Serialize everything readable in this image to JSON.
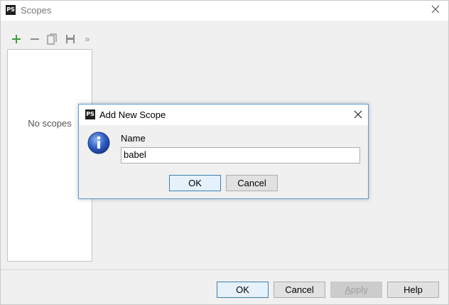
{
  "window": {
    "app_icon_text": "PS",
    "title": "Scopes"
  },
  "toolbar": {
    "more_label": "»"
  },
  "scope_list": {
    "empty_text": "No scopes"
  },
  "footer": {
    "ok_label": "OK",
    "cancel_label": "Cancel",
    "apply_mnemonic": "A",
    "apply_rest": "pply",
    "help_label": "Help"
  },
  "dialog": {
    "app_icon_text": "PS",
    "title": "Add New Scope",
    "name_label": "Name",
    "name_value": "babel",
    "ok_label": "OK",
    "cancel_label": "Cancel"
  },
  "colors": {
    "add_icon": "#3d9e3d",
    "dialog_border": "#5b9bd5",
    "default_button_border": "#3c7fb1"
  }
}
